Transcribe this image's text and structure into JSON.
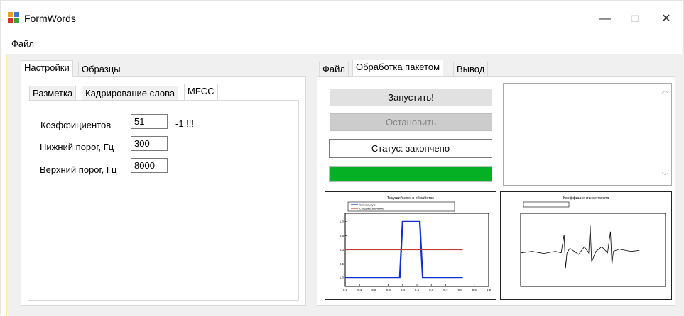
{
  "window": {
    "title": "FormWords",
    "minimize_glyph": "—",
    "maximize_glyph": "☐",
    "close_glyph": "✕"
  },
  "menu": {
    "file": "Файл"
  },
  "left_tabs": {
    "settings": "Настройки",
    "samples": "Образцы"
  },
  "inner_tabs": {
    "markup": "Разметка",
    "cropping": "Кадрирование слова",
    "mfcc": "MFCC"
  },
  "mfcc": {
    "coef_label": "Коэффициентов",
    "coef_value": "51",
    "coef_note": "-1 !!!",
    "low_label": "Нижний порог, Гц",
    "low_value": "300",
    "high_label": "Верхний порог, Гц",
    "high_value": "8000"
  },
  "right_tabs": {
    "file": "Файл",
    "batch": "Обработка пакетом",
    "output": "Вывод"
  },
  "batch": {
    "start_label": "Запустить!",
    "stop_label": "Остановить",
    "status_text": "Статус: закончено",
    "progress": 1.0,
    "progress_color": "#06b025"
  },
  "chart_data": [
    {
      "type": "line",
      "title": "Текущий звук в обработке",
      "xlim": [
        0,
        1.0
      ],
      "ylim": [
        -1.3,
        1.3
      ],
      "x_ticks": [
        "0.0",
        "0.1",
        "0.2",
        "0.3",
        "0.4",
        "0.5",
        "0.6",
        "0.7",
        "0.8",
        "0.9",
        "1.0"
      ],
      "y_ticks": [
        "1.0",
        "0.5",
        "0.0",
        "-0.5",
        "-1.0"
      ],
      "series": [
        {
          "name": "Сигнальную",
          "color": "#1030d0",
          "x": [
            0.0,
            0.32,
            0.38,
            0.4,
            0.46,
            0.52,
            0.54,
            0.6,
            0.82
          ],
          "y": [
            -1.0,
            -1.0,
            -1.0,
            1.0,
            1.0,
            1.0,
            -1.0,
            -1.0,
            -1.0
          ]
        },
        {
          "name": "Среднее значение",
          "color": "#c04040",
          "x": [
            0.0,
            0.82
          ],
          "y": [
            0.0,
            0.0
          ]
        }
      ]
    },
    {
      "type": "line",
      "title": "Коэффициенты сегмента",
      "xlim": [
        0,
        1.0
      ],
      "ylim": [
        -1.2,
        1.2
      ],
      "series": [
        {
          "color": "#000000",
          "x": [
            0.0,
            0.08,
            0.16,
            0.24,
            0.28,
            0.3,
            0.31,
            0.32,
            0.34,
            0.4,
            0.44,
            0.47,
            0.48,
            0.49,
            0.52,
            0.56,
            0.6,
            0.62,
            0.63,
            0.64,
            0.68,
            0.76,
            0.82
          ],
          "y": [
            -0.1,
            -0.05,
            -0.12,
            -0.05,
            -0.1,
            0.5,
            -0.6,
            -0.1,
            0.05,
            -0.15,
            0.1,
            -0.1,
            0.8,
            -0.4,
            -0.05,
            0.1,
            -0.1,
            0.6,
            -0.5,
            -0.05,
            0.02,
            -0.05,
            -0.02
          ]
        }
      ]
    }
  ]
}
